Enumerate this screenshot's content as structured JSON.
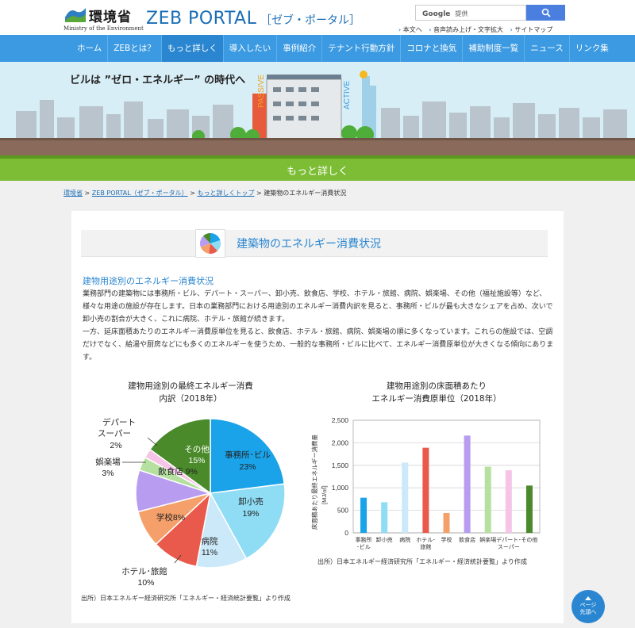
{
  "header": {
    "org_name": "環境省",
    "org_en": "Ministry of the Environment",
    "portal_title": "ZEB PORTAL",
    "portal_sub": "［ゼブ・ポータル］",
    "search_brand": "Google",
    "search_placeholder": "提供",
    "util_links": [
      "本文へ",
      "音声読み上げ・文字拡大",
      "サイトマップ"
    ]
  },
  "nav": {
    "items": [
      "ホーム",
      "ZEBとは？",
      "もっと詳しく",
      "導入したい",
      "事例紹介",
      "テナント行動方針",
      "コロナと換気",
      "補助制度一覧",
      "ニュース",
      "リンク集"
    ],
    "active_index": 2
  },
  "hero": {
    "title": "ビルは ”ゼロ・エネルギー” の時代へ",
    "passive": "PASSIVE",
    "active": "ACTIVE"
  },
  "section_title": "もっと詳しく",
  "breadcrumb": {
    "links": [
      "環境省",
      "ZEB PORTAL（ゼブ・ポータル）",
      "もっと詳しくトップ"
    ],
    "current": "建築物のエネルギー消費状況"
  },
  "page": {
    "title": "建築物のエネルギー消費状況",
    "subtitle": "建物用途別のエネルギー消費状況",
    "paragraph1": "業務部門の建築物には事務所・ビル、デパート・スーパー、卸小売、飲食店、学校、ホテル・旅館、病院、娯楽場、その他（福祉施設等）など、様々な用途の施設が存在します。日本の業務部門における用途別のエネルギー消費内訳を見ると、事務所・ビルが最も大きなシェアを占め、次いで卸小売の割合が大きく、これに病院、ホテル・旅館が続きます。",
    "paragraph2": "一方、延床面積あたりのエネルギー消費原単位を見ると、飲食店、ホテル・旅館、病院、娯楽場の順に多くなっています。これらの施設では、空調だけでなく、給湯や厨房などにも多くのエネルギーを使うため、一般的な事務所・ビルに比べて、エネルギー消費原単位が大きくなる傾向にあります。",
    "source1": "出所）日本エネルギー経済研究所「エネルギー・経済統計要覧」より作成",
    "source2": "出所）日本エネルギー経済研究所「エネルギー・経済統計要覧」より作成"
  },
  "page_top": {
    "line1": "ページ",
    "line2": "先頭へ"
  },
  "chart_data": [
    {
      "type": "pie",
      "title_line1": "建物用途別の最終エネルギー消費",
      "title_line2": "内訳（2018年）",
      "slices": [
        {
          "label": "事務所･ビル",
          "value_label": "23%",
          "value": 23,
          "color": "#1aa3e8"
        },
        {
          "label": "卸小売",
          "value_label": "19%",
          "value": 19,
          "color": "#8fdcf5"
        },
        {
          "label": "病院",
          "value_label": "11%",
          "value": 11,
          "color": "#cbe9f8"
        },
        {
          "label": "ホテル･旅館",
          "value_label": "10%",
          "value": 10,
          "color": "#ea5a4c"
        },
        {
          "label": "学校",
          "value_label": "8%",
          "value": 8,
          "color": "#f5a06a"
        },
        {
          "label": "飲食店",
          "value_label": "9%",
          "value": 9,
          "color": "#b89cf0"
        },
        {
          "label": "娯楽場",
          "value_label": "3%",
          "value": 3,
          "color": "#b6e0a0"
        },
        {
          "label": "デパートスーパー",
          "value_label": "2%",
          "value": 2,
          "color": "#f5c4e6"
        },
        {
          "label": "その他",
          "value_label": "15%",
          "value": 15,
          "color": "#4a8a2a"
        }
      ],
      "outer_labels": {
        "dept_line1": "デパート",
        "dept_line2": "スーパー",
        "dept_val": "2%",
        "amuse": "娯楽場",
        "amuse_val": "3%",
        "hotel": "ホテル･旅館",
        "hotel_val": "10%"
      },
      "inner_labels": {
        "other": "その他",
        "other_val": "15%",
        "office": "事務所･ビル",
        "office_val": "23%",
        "retail": "卸小売",
        "retail_val": "19%",
        "hospital": "病院",
        "hospital_val": "11%",
        "school": "学校8%",
        "food": "飲食店 9%"
      }
    },
    {
      "type": "bar",
      "title_line1": "建物用途別の床面積あたり",
      "title_line2": "エネルギー消費原単位（2018年）",
      "ylabel": "床面積あたり最終エネルギー消費量",
      "yunit": "[MJ/㎡]",
      "ylim": [
        0,
        2500
      ],
      "yticks": [
        0,
        500,
        1000,
        1500,
        2000,
        2500
      ],
      "ytick_labels": [
        "0",
        "500",
        "1,000",
        "1,500",
        "2,000",
        "2,500"
      ],
      "categories": [
        {
          "line1": "事務所",
          "line2": "･ビル"
        },
        {
          "line1": "卸小売",
          "line2": ""
        },
        {
          "line1": "病院",
          "line2": ""
        },
        {
          "line1": "ホテル･",
          "line2": "旅館"
        },
        {
          "line1": "学校",
          "line2": ""
        },
        {
          "line1": "飲食店",
          "line2": ""
        },
        {
          "line1": "娯楽場",
          "line2": ""
        },
        {
          "line1": "デパート･",
          "line2": "スーパー"
        },
        {
          "line1": "その他",
          "line2": ""
        }
      ],
      "values": [
        780,
        680,
        1560,
        1890,
        440,
        2160,
        1470,
        1390,
        1050
      ],
      "colors": [
        "#1aa3e8",
        "#8fdcf5",
        "#cbe9f8",
        "#ea5a4c",
        "#f5a06a",
        "#b89cf0",
        "#b6e0a0",
        "#f5c4e6",
        "#4a8a2a"
      ],
      "grid": true
    }
  ]
}
